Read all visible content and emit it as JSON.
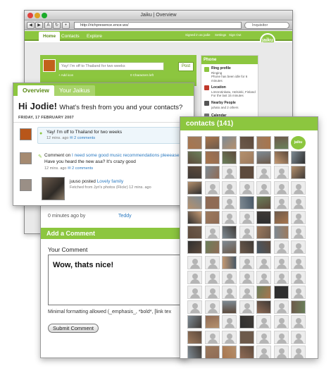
{
  "browser": {
    "title": "Jaiku | Overview",
    "url": "http://richpresence.ence.ws/",
    "search_placeholder": "Inquisitor",
    "nav": {
      "tabs": [
        "Home",
        "Contacts",
        "Explore"
      ],
      "right_links": [
        "Signed in as jodie",
        "Settings",
        "Sign Out"
      ]
    },
    "logo_text": "jaiku",
    "post": {
      "value": "Yay! I'm off to Thailand for two weeks",
      "add_icon_label": "+ Add icon",
      "chars_left": "0 Characters left",
      "button": "Post"
    },
    "phone_panel": {
      "title": "Phone",
      "items": [
        {
          "title": "Ring profile",
          "lines": [
            "Ringing",
            "Phone has been idle for 6",
            "minutes"
          ]
        },
        {
          "title": "Location",
          "lines": [
            "Lönnrotinkatu, Helsinki, Finland",
            "For the last 15 minutes"
          ]
        },
        {
          "title": "Nearby People",
          "lines": [
            "juhato and 2 others"
          ]
        },
        {
          "title": "Calendar",
          "lines": []
        }
      ]
    }
  },
  "overview": {
    "tabs": [
      "Overview",
      "Your Jaikus"
    ],
    "greeting_name": "Hi Jodie!",
    "greeting_question": "What's fresh from you and your contacts?",
    "date": "FRIDAY, 17 FEBRUARY 2007",
    "entries": [
      {
        "text": "Yay! I'm off to Thailand for two weeks",
        "meta_time": "12 mins. ago",
        "meta_link": "2 comments"
      },
      {
        "text_prefix": "Comment on",
        "text_link": "I need some good music recommendations pleeease",
        "text_line2": "Have you heard the new asa? It's crazy good",
        "meta_time": "12 mins. ago",
        "meta_link": "2 comments"
      },
      {
        "text_prefix": "juuso posted",
        "text_link": "Lovely family",
        "text_line2": "Fetched from Jyri's photos (Flickr) 12 mins. ago"
      }
    ]
  },
  "comment": {
    "prev_time": "0 minutes ago by",
    "prev_author": "Teddy",
    "header": "Add a Comment",
    "label": "Your Comment",
    "value": "Wow, thats nice!",
    "format_note": "Minimal formatting allowed (_emphasis_, *bold*, [link tex",
    "submit": "Submit Comment"
  },
  "contacts": {
    "title": "contacts (141)",
    "logo_text": "jaiku"
  },
  "colors": {
    "brand_green": "#8cc63f",
    "link_blue": "#2a79c0"
  }
}
